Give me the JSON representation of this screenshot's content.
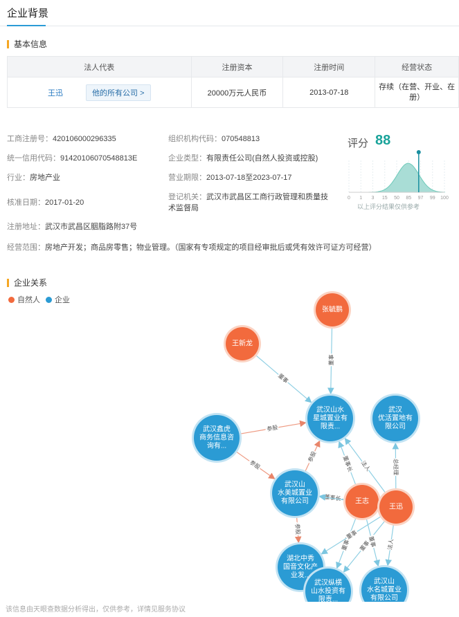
{
  "page_title": "企业背景",
  "basic_section": {
    "title": "基本信息",
    "headers": [
      "法人代表",
      "注册资本",
      "注册时间",
      "经营状态"
    ],
    "legal_rep": "王迅",
    "all_companies_btn": "他的所有公司 >",
    "capital": "20000万元人民币",
    "reg_date": "2013-07-18",
    "status_line1": "存续（在营、开业、在",
    "status_line2": "册）"
  },
  "details": {
    "reg_no_label": "工商注册号：",
    "reg_no": "420106000296335",
    "org_code_label": "组织机构代码：",
    "org_code": "070548813",
    "credit_label": "统一信用代码：",
    "credit": "91420106070548813E",
    "type_label": "企业类型：",
    "type": "有限责任公司(自然人投资或控股)",
    "industry_label": "行业：",
    "industry": "房地产业",
    "period_label": "营业期限：",
    "period": "2013-07-18至2023-07-17",
    "approve_label": "核准日期：",
    "approve": "2017-01-20",
    "authority_label": "登记机关：",
    "authority_line1": "武汉市武昌区工商行政管理和质量技",
    "authority_line2": "术监督局",
    "address_label": "注册地址：",
    "address": "武汉市武昌区胭脂路附37号",
    "scope_label": "经营范围：",
    "scope": "房地产开发；商品房零售；物业管理。（国家有专项规定的项目经审批后或凭有效许可证方可经营）"
  },
  "score": {
    "label": "评分",
    "value": "88",
    "ticks": [
      "0",
      "1",
      "3",
      "15",
      "50",
      "85",
      "97",
      "99",
      "100"
    ],
    "note": "以上评分结果仅供参考",
    "marker_fraction": 0.88
  },
  "relation_section": {
    "title": "企业关系",
    "legend_person": "自然人",
    "legend_company": "企业",
    "person_color": "#f26a3d",
    "company_color": "#2b9bd4"
  },
  "graph": {
    "nodes": [
      {
        "id": "zhang",
        "kind": "person",
        "lines": [
          "张毓鹏"
        ]
      },
      {
        "id": "wangxl",
        "kind": "person",
        "lines": [
          "王新龙"
        ]
      },
      {
        "id": "wangzhi",
        "kind": "person",
        "lines": [
          "王志"
        ]
      },
      {
        "id": "wangxun",
        "kind": "person",
        "lines": [
          "王迅"
        ]
      },
      {
        "id": "xingcheng",
        "kind": "company",
        "lines": [
          "武汉山水",
          "星城置业有",
          "限责..."
        ]
      },
      {
        "id": "youhuo",
        "kind": "company",
        "lines": [
          "武汉",
          "优活置地有",
          "限公司"
        ]
      },
      {
        "id": "xinhu",
        "kind": "company",
        "lines": [
          "武汉鑫虎",
          "商务信息咨",
          "询有..."
        ]
      },
      {
        "id": "shuimei",
        "kind": "company",
        "lines": [
          "武汉山",
          "水美城置业",
          "有限公司"
        ]
      },
      {
        "id": "zhongxiu",
        "kind": "company",
        "lines": [
          "湖北中秀",
          "国音文化产",
          "业发..."
        ]
      },
      {
        "id": "zongheng",
        "kind": "company",
        "lines": [
          "武汉纵横",
          "山水投资有",
          "限责..."
        ]
      },
      {
        "id": "shuiming",
        "kind": "company",
        "lines": [
          "武汉山",
          "水名城置业",
          "有限公司"
        ]
      }
    ],
    "edges": [
      {
        "from": "zhang",
        "to": "xingcheng",
        "label": "董事"
      },
      {
        "from": "wangxl",
        "to": "xingcheng",
        "label": "董事"
      },
      {
        "from": "xinhu",
        "to": "xingcheng",
        "label": "参股"
      },
      {
        "from": "xinhu",
        "to": "shuimei",
        "label": "参股"
      },
      {
        "from": "shuimei",
        "to": "xingcheng",
        "label": "参股"
      },
      {
        "from": "wangzhi",
        "to": "xingcheng",
        "label": "董事长"
      },
      {
        "from": "wangxun",
        "to": "xingcheng",
        "label": "法人"
      },
      {
        "from": "wangxun",
        "to": "youhuo",
        "label": "总经理"
      },
      {
        "from": "wangzhi",
        "to": "shuimei",
        "label": "董事长"
      },
      {
        "from": "wangxun",
        "to": "shuimei",
        "label": "董事"
      },
      {
        "from": "shuimei",
        "to": "zhongxiu",
        "label": "参股"
      },
      {
        "from": "wangzhi",
        "to": "zongheng",
        "label": "董事长"
      },
      {
        "from": "wangxun",
        "to": "zongheng",
        "label": "董事"
      },
      {
        "from": "wangxun",
        "to": "shuiming",
        "label": "法人"
      },
      {
        "from": "wangzhi",
        "to": "shuiming",
        "label": "董事"
      },
      {
        "from": "zongheng",
        "to": "zhongxiu",
        "label": "参股"
      },
      {
        "from": "wangxun",
        "to": "zhongxiu",
        "label": "董事"
      }
    ]
  },
  "footer": "该信息由天眼查数据分析得出，仅供参考，详情见服务协议"
}
